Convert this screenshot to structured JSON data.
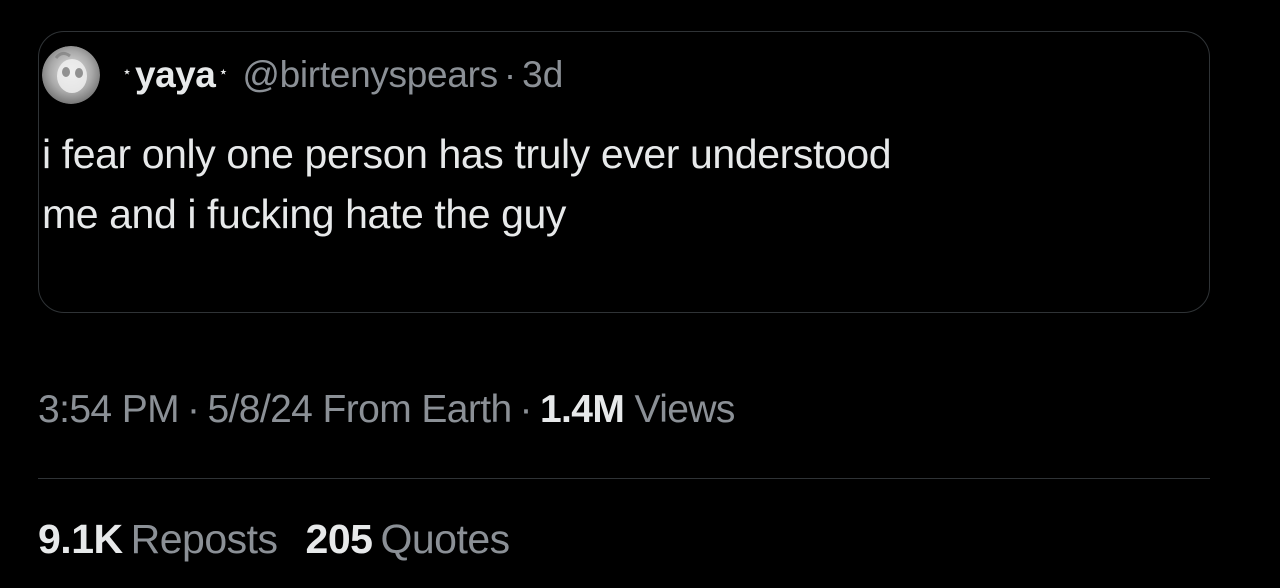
{
  "quote": {
    "star_left": "⋆",
    "display_name": "yaya",
    "star_right": "⋆",
    "handle": "@birtenyspears",
    "separator": "·",
    "age": "3d",
    "text_line1": "i fear only one person has truly ever understood",
    "text_line2": "me and i fucking hate the guy"
  },
  "meta": {
    "time": "3:54 PM",
    "separator": "·",
    "date_source": "5/8/24 From Earth",
    "views_count": "1.4M",
    "views_label": "Views"
  },
  "stats": {
    "reposts_count": "9.1K",
    "reposts_label": "Reposts",
    "quotes_count": "205",
    "quotes_label": "Quotes"
  },
  "colors": {
    "background": "#000000",
    "primary_text": "#e7e9ea",
    "secondary_text": "#8b9096",
    "border": "#2f3336"
  },
  "icons": {
    "avatar": "user-avatar-icon"
  }
}
